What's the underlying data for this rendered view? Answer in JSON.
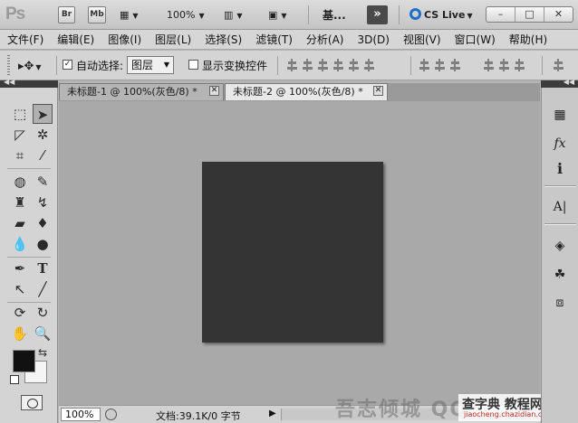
{
  "app": {
    "logo": "Ps",
    "bridge_button": "Br",
    "minibridge_button": "Mb",
    "zoom_value": "100%",
    "workspace_name": "基...",
    "more_button": "»",
    "cs_live": "CS Live",
    "window_controls": [
      "–",
      "□",
      "✕"
    ]
  },
  "menu": [
    "文件(F)",
    "编辑(E)",
    "图像(I)",
    "图层(L)",
    "选择(S)",
    "滤镜(T)",
    "分析(A)",
    "3D(D)",
    "视图(V)",
    "窗口(W)",
    "帮助(H)"
  ],
  "options": {
    "auto_select_label": "自动选择:",
    "auto_select_checked": true,
    "auto_select_target": "图层",
    "show_transform_label": "显示变换控件",
    "show_transform_checked": false
  },
  "tabs": [
    {
      "title": "未标题-1 @ 100%(灰色/8) *",
      "active": false
    },
    {
      "title": "未标题-2 @ 100%(灰色/8) *",
      "active": true
    }
  ],
  "document": {
    "fill_color": "#343434",
    "canvas_bg": "#a9a9a9"
  },
  "status": {
    "zoom": "100%",
    "doc_info": "文档:39.1K/0 字节",
    "arrow": "▶"
  },
  "colors": {
    "foreground": "#111111",
    "background": "#f5f5f5"
  },
  "watermark": {
    "text": "吾志倾城 QQ",
    "site_big": "查字典 教程网",
    "site_small": "jiaocheng.chazidian.com"
  },
  "tools_icons": [
    "marquee-icon",
    "move-icon",
    "lasso-icon",
    "quick-select-icon",
    "crop-icon",
    "eyedropper-icon",
    "spot-heal-icon",
    "brush-icon",
    "stamp-icon",
    "history-brush-icon",
    "eraser-icon",
    "paint-bucket-icon",
    "blur-icon",
    "dodge-icon",
    "pen-icon",
    "type-icon",
    "path-select-icon",
    "line-icon",
    "3d-rotate-icon",
    "3d-orbit-icon",
    "hand-icon",
    "zoom-icon"
  ],
  "right_dock_icons": [
    "histogram-icon",
    "fx-styles-icon",
    "info-icon",
    "character-icon",
    "layers-icon",
    "channels-icon",
    "transform-icon"
  ]
}
